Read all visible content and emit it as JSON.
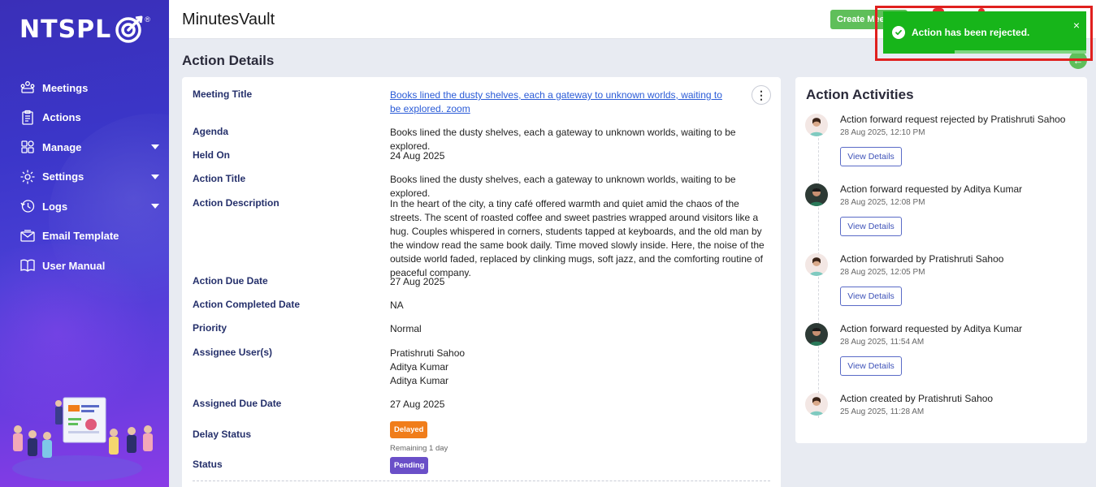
{
  "brand": {
    "logo_text": "NTSPL"
  },
  "sidebar": {
    "items": [
      {
        "label": "Meetings",
        "icon": "meetings-icon",
        "has_caret": false
      },
      {
        "label": "Actions",
        "icon": "clipboard-icon",
        "has_caret": false
      },
      {
        "label": "Manage",
        "icon": "grid-icon",
        "has_caret": true
      },
      {
        "label": "Settings",
        "icon": "gear-icon",
        "has_caret": true
      },
      {
        "label": "Logs",
        "icon": "history-icon",
        "has_caret": true
      },
      {
        "label": "Email Template",
        "icon": "envelope-icon",
        "has_caret": false
      },
      {
        "label": "User Manual",
        "icon": "book-icon",
        "has_caret": false
      }
    ]
  },
  "header": {
    "app_title": "MinutesVault",
    "create_button": "Create Meeting"
  },
  "page": {
    "title": "Action Details"
  },
  "details": {
    "meeting_title_label": "Meeting Title",
    "meeting_title_value": "Books lined the dusty shelves, each a gateway to unknown worlds, waiting to be explored. zoom",
    "agenda_label": "Agenda",
    "agenda_value": "Books lined the dusty shelves, each a gateway to unknown worlds, waiting to be explored.",
    "held_on_label": "Held On",
    "held_on_value": "24 Aug 2025",
    "action_title_label": "Action Title",
    "action_title_value": "Books lined the dusty shelves, each a gateway to unknown worlds, waiting to be explored.",
    "action_description_label": "Action Description",
    "action_description_value": "In the heart of the city, a tiny café offered warmth and quiet amid the chaos of the streets. The scent of roasted coffee and sweet pastries wrapped around visitors like a hug. Couples whispered in corners, students tapped at keyboards, and the old man by the window read the same book daily. Time moved slowly inside. Here, the noise of the outside world faded, replaced by clinking mugs, soft jazz, and the comforting routine of peaceful company.",
    "action_due_date_label": "Action Due Date",
    "action_due_date_value": "27 Aug 2025",
    "action_completed_date_label": "Action Completed Date",
    "action_completed_date_value": "NA",
    "priority_label": "Priority",
    "priority_value": "Normal",
    "assignee_label": "Assignee User(s)",
    "assignees": [
      "Pratishruti Sahoo",
      "Aditya Kumar",
      "Aditya Kumar"
    ],
    "assigned_due_date_label": "Assigned Due Date",
    "assigned_due_date_value": "27 Aug 2025",
    "delay_status_label": "Delay Status",
    "delay_status_badge": "Delayed",
    "delay_status_sub": "Remaining 1 day",
    "status_label": "Status",
    "status_badge": "Pending"
  },
  "activities": {
    "title": "Action Activities",
    "view_details_label": "View Details",
    "items": [
      {
        "text": "Action forward request rejected by Pratishruti Sahoo",
        "time": "28 Aug 2025, 12:10 PM",
        "avatar": "female",
        "has_button": true
      },
      {
        "text": "Action forward requested by Aditya Kumar",
        "time": "28 Aug 2025, 12:08 PM",
        "avatar": "male",
        "has_button": true
      },
      {
        "text": "Action forwarded by Pratishruti Sahoo",
        "time": "28 Aug 2025, 12:05 PM",
        "avatar": "female",
        "has_button": true
      },
      {
        "text": "Action forward requested by Aditya Kumar",
        "time": "28 Aug 2025, 11:54 AM",
        "avatar": "male",
        "has_button": true
      },
      {
        "text": "Action created by Pratishruti Sahoo",
        "time": "25 Aug 2025, 11:28 AM",
        "avatar": "female",
        "has_button": false
      }
    ]
  },
  "toast": {
    "message": "Action has been rejected.",
    "close": "×",
    "color": "#17b51a"
  },
  "colors": {
    "accent": "#3e52b8",
    "label": "#25306b",
    "delayed": "#f07d1a",
    "pending": "#6a4fc8",
    "highlight": "#e0201e"
  }
}
